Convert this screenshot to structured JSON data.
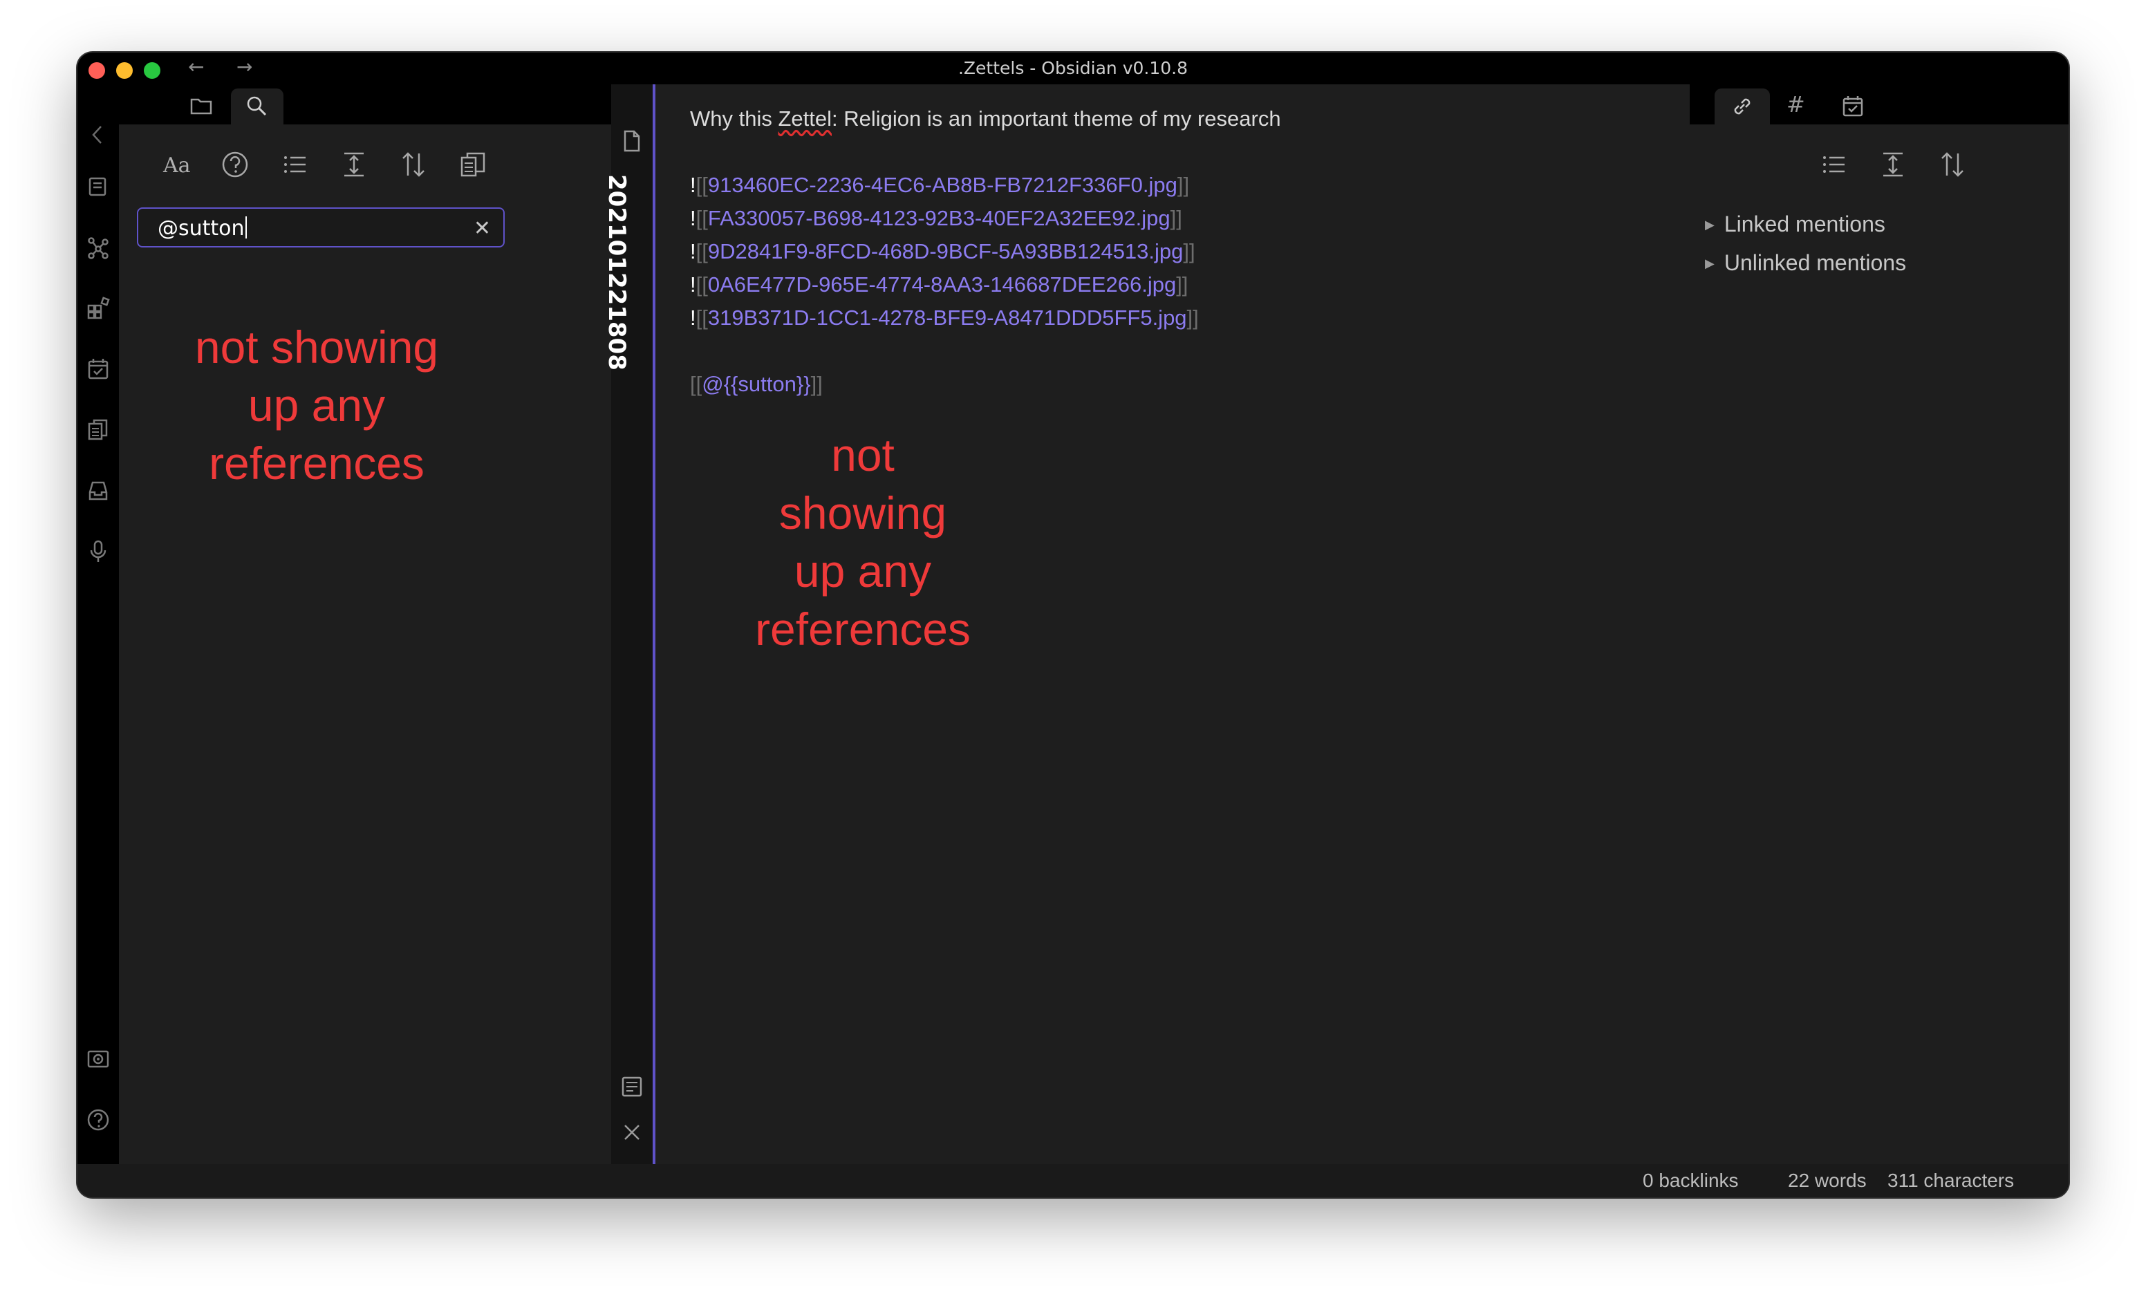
{
  "window": {
    "title": ".Zettels - Obsidian v0.10.8",
    "back_arrow": "←",
    "forward_arrow": "→"
  },
  "ribbon": {
    "icons": [
      "open-quick-switcher-icon",
      "graph-view-icon",
      "plugins-icon",
      "daily-note-icon",
      "templates-icon",
      "archive-icon",
      "audio-recorder-icon",
      "vault-icon",
      "help-icon",
      "settings-icon"
    ]
  },
  "left_sidebar": {
    "tabs": [
      "folder-icon",
      "search-icon"
    ],
    "tools": [
      "match-case-icon",
      "search-help-icon",
      "list-icon",
      "collapse-icon",
      "sort-icon",
      "copy-results-icon"
    ],
    "match_case_label": "Aa",
    "search_value": "@sutton",
    "clear_label": "✕",
    "annotation": [
      "not showing",
      "up any",
      "references"
    ]
  },
  "note": {
    "title": "202101221808",
    "lines": {
      "l1_a": "Why this ",
      "l1_b": "Zettel",
      "l1_c": ": Religion is an important theme of my research",
      "img1": "913460EC-2236-4EC6-AB8B-FB7212F336F0.jpg",
      "img2": "FA330057-B698-4123-92B3-40EF2A32EE92.jpg",
      "img3": "9D2841F9-8FCD-468D-9BCF-5A93BB124513.jpg",
      "img4": "0A6E477D-965E-4774-8AA3-146687DEE266.jpg",
      "img5": "319B371D-1CC1-4278-BFE9-A8471DDD5FF5.jpg",
      "ref": "@{{sutton}}"
    },
    "bang": "!",
    "open_brackets": "[[",
    "close_brackets": "]]",
    "annotation": [
      "not showing",
      "up any",
      "references"
    ]
  },
  "right_sidebar": {
    "tabs": [
      "link-icon",
      "tag-icon",
      "calendar-icon"
    ],
    "tab_tag_label": "#",
    "tools": [
      "list-icon",
      "collapse-icon",
      "sort-icon"
    ],
    "linked_mentions": "Linked mentions",
    "unlinked_mentions": "Unlinked mentions",
    "triangle": "▶"
  },
  "status_bar": {
    "backlinks": "0 backlinks",
    "words": "22 words",
    "characters": "311 characters"
  },
  "colors": {
    "accent": "#5f52c9",
    "link": "#8c7cf0",
    "annotation": "#ef3a3a",
    "pane": "#1e1e1e"
  }
}
